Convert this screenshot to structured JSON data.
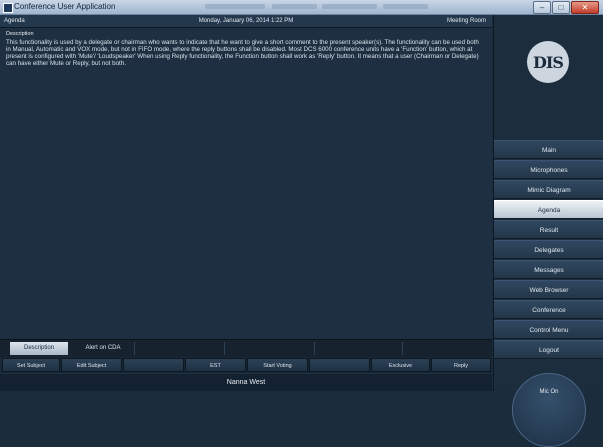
{
  "window": {
    "title": "Conference User Application"
  },
  "header": {
    "left": "Agenda",
    "center": "Monday, January 06, 2014 1:22 PM",
    "right": "Meeting Room"
  },
  "description": {
    "heading": "Description",
    "body": "This functionality is used by a delegate or chairman who wants to indicate that he want to give a short comment to the present speaker(s). The functionality can be used both in Manual, Automatic and VOX mode, but not in FIFO mode, where the reply buttons shall be disabled. Most DCS 6000 conference units have a 'Function' button, which at present is configured with 'Mute'/ 'Loudspeaker' When using Reply functionality, the Function button shall work as 'Reply' button. It means that a user (Chairman or Delegate) can have either Mute or Reply, but not both."
  },
  "tabs": [
    "Description",
    "Alert on CDA"
  ],
  "buttons": [
    "Set Subject",
    "Edit Subject",
    "",
    "EST",
    "Start Voting",
    "",
    "Exclusive",
    "Reply"
  ],
  "status": {
    "name": "Nanna West"
  },
  "logo": {
    "text": "DIS"
  },
  "menu": {
    "active": "Agenda",
    "items": [
      "Main",
      "Microphones",
      "Mimic Diagram",
      "Agenda",
      "Result",
      "Delegates",
      "Messages",
      "Web Browser",
      "Conference",
      "Control Menu",
      "Logout"
    ]
  },
  "mic": {
    "label": "Mic On"
  },
  "colors": {
    "background": "#1e2f41",
    "accent_active": "#dde5ee",
    "sidebar": "#1c2d3e"
  }
}
